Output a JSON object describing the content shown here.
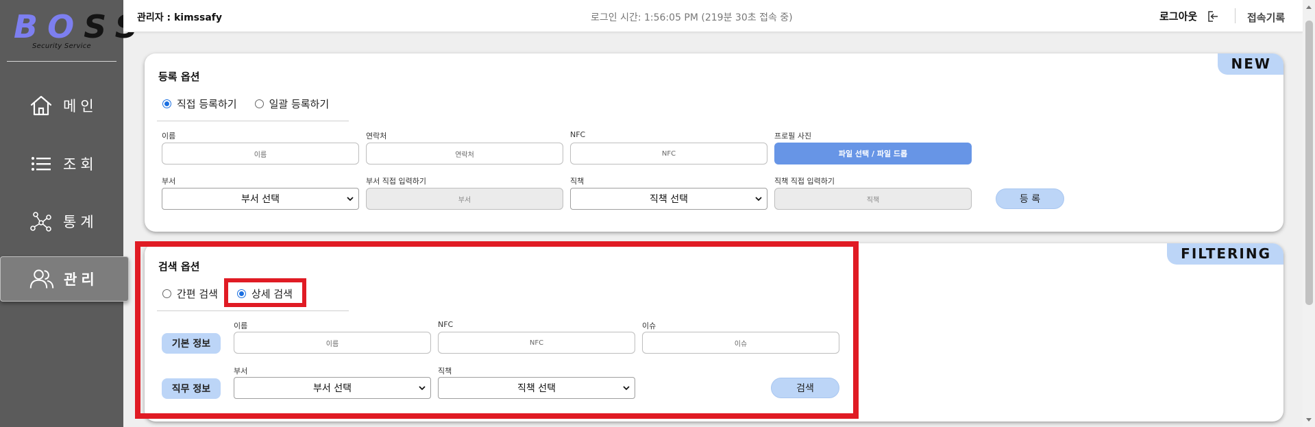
{
  "logo": {
    "letters": [
      "B",
      "O",
      "S",
      "S"
    ],
    "subtitle": "Security Service"
  },
  "nav": [
    {
      "label": "메인",
      "icon": "home-icon"
    },
    {
      "label": "조회",
      "icon": "list-icon"
    },
    {
      "label": "통계",
      "icon": "network-icon"
    },
    {
      "label": "관리",
      "icon": "users-icon",
      "active": true
    }
  ],
  "header": {
    "admin": "관리자 : kimssafy",
    "login_time": "로그인 시간: 1:56:05 PM (219분 30초 접속 중)",
    "logout": "로그아웃",
    "access_log": "접속기록"
  },
  "register": {
    "tag": "NEW",
    "title": "등록 옵션",
    "radios": [
      {
        "label": "직접 등록하기",
        "checked": true
      },
      {
        "label": "일괄 등록하기",
        "checked": false
      }
    ],
    "fields": {
      "name": {
        "label": "이름",
        "placeholder": "이름"
      },
      "contact": {
        "label": "연락처",
        "placeholder": "연락처"
      },
      "nfc": {
        "label": "NFC",
        "placeholder": "NFC"
      },
      "photo": {
        "label": "프로필 사진",
        "button": "파일 선택 / 파일 드롭"
      },
      "dept": {
        "label": "부서",
        "value": "부서 선택"
      },
      "dept_input": {
        "label": "부서 직접 입력하기",
        "placeholder": "부서"
      },
      "position": {
        "label": "직책",
        "value": "직책 선택"
      },
      "position_input": {
        "label": "직책 직접 입력하기",
        "placeholder": "직책"
      }
    },
    "submit": "등 록"
  },
  "filter": {
    "tag": "FILTERING",
    "title": "검색 옵션",
    "radios": [
      {
        "label": "간편 검색",
        "checked": false
      },
      {
        "label": "상세 검색",
        "checked": true
      }
    ],
    "basic_tag": "기본 정보",
    "job_tag": "직무 정보",
    "fields": {
      "name": {
        "label": "이름",
        "placeholder": "이름"
      },
      "nfc": {
        "label": "NFC",
        "placeholder": "NFC"
      },
      "issue": {
        "label": "이슈",
        "placeholder": "이슈"
      },
      "dept": {
        "label": "부서",
        "value": "부서 선택"
      },
      "position": {
        "label": "직책",
        "value": "직책 선택"
      }
    },
    "search": "검색"
  },
  "colors": {
    "sidebar": "#5b5b5b",
    "accent": "#6795e6",
    "pill": "#bcd5f7",
    "highlight": "#e01b24"
  }
}
